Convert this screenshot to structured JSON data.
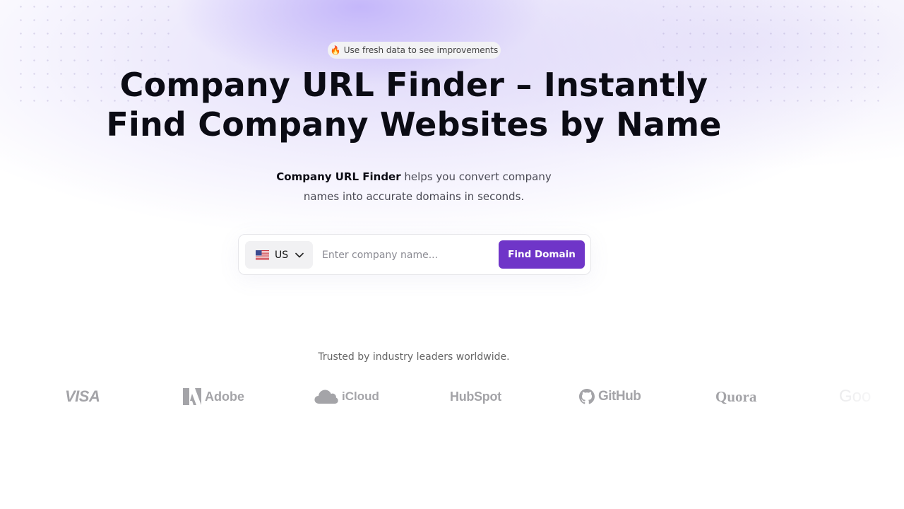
{
  "badge": {
    "icon": "flame-icon",
    "text": "Use fresh data to see improvements"
  },
  "hero": {
    "title_line1": "Company URL Finder – Instantly",
    "title_line2": "Find Company Websites by Name",
    "subtitle_bold": "Company URL Finder",
    "subtitle_rest": " helps you convert company",
    "subtitle_line2": "names into accurate domains in seconds."
  },
  "search": {
    "country_code": "US",
    "country_flag_icon": "us-flag-icon",
    "placeholder": "Enter company name...",
    "value": "",
    "button_label": "Find Domain"
  },
  "trusted": {
    "text": "Trusted by industry leaders worldwide.",
    "logos": [
      "VISA",
      "Adobe",
      "iCloud",
      "HubSpot",
      "GitHub",
      "Quora",
      "Goo"
    ]
  },
  "colors": {
    "accent": "#6f35c8",
    "logo_gray": "#a4a4a8"
  }
}
